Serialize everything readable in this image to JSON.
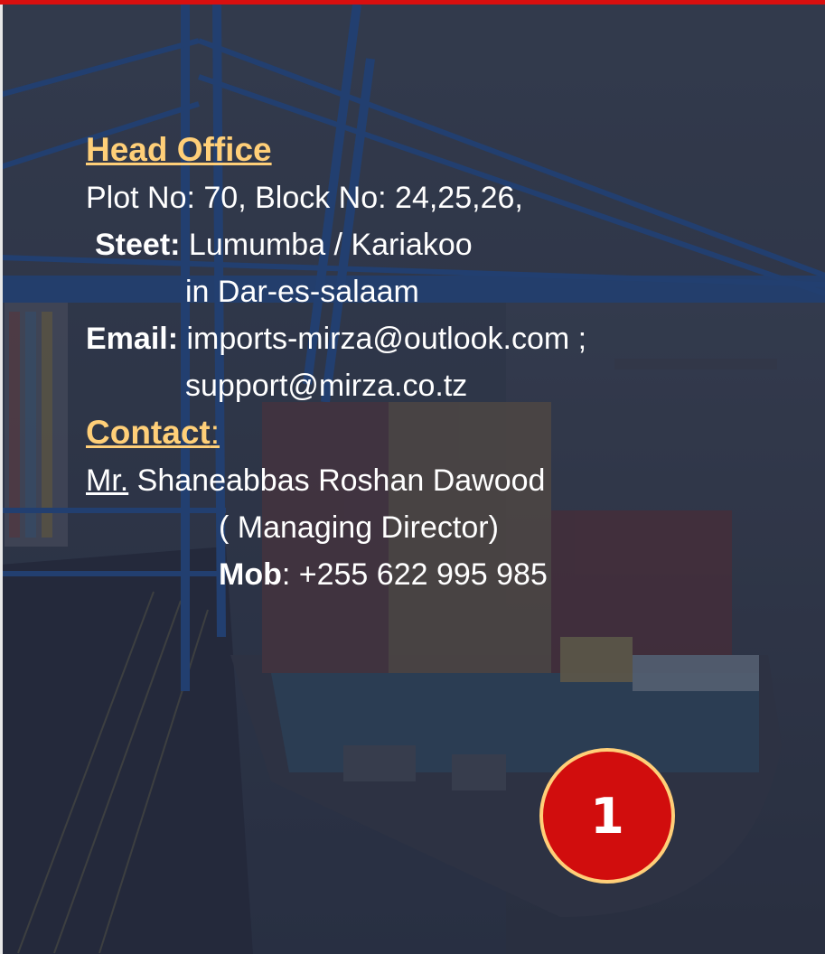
{
  "head_office": {
    "heading": "Head Office",
    "address_line1": "Plot No: 70, Block No: 24,25,26,",
    "street_label": "Steet:",
    "street_value": "Lumumba / Kariakoo",
    "city": "in Dar-es-salaam",
    "email_label": "Email:",
    "email_primary": "imports-mirza@outlook.com ;",
    "email_secondary": "support@mirza.co.tz"
  },
  "contact": {
    "heading": "Contact",
    "colon": ":",
    "salutation": "Mr.",
    "name": "Shaneabbas Roshan Dawood",
    "role": "( Managing Director)",
    "mob_label": "Mob",
    "mob_value": ": +255 622 995 985"
  },
  "page_badge": "1",
  "colors": {
    "accent_red": "#d90f0f",
    "heading_gold": "#ffcf78",
    "overlay": "#262c3e"
  }
}
